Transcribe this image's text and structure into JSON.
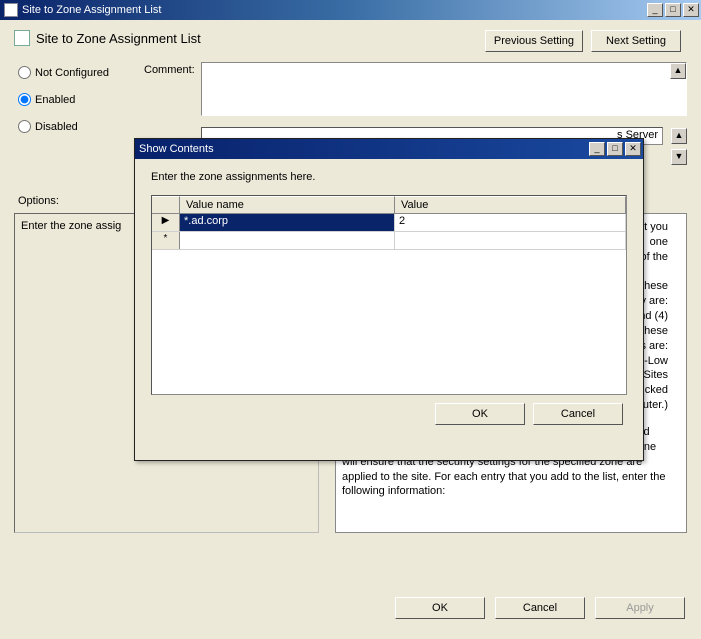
{
  "main_window": {
    "title": "Site to Zone Assignment List",
    "heading": "Site to Zone Assignment List",
    "nav": {
      "prev": "Previous Setting",
      "next": "Next Setting"
    },
    "radio": {
      "not_configured": "Not Configured",
      "enabled": "Enabled",
      "disabled": "Disabled",
      "selected": "enabled"
    },
    "comment_label": "Comment:",
    "comment_value": "",
    "supports_value": "s Server",
    "options_label": "Options:",
    "left_panel_text": "Enter the zone assig",
    "help_text_top": "t you\none\nll of the\n\n these\n They are:\n and (4)\n of these\ntings are:\nn-Low\nted Sites\ncked\nct your local computer.)",
    "help_text_bottom": "If you enable this policy setting, you can enter a list of sites and their related zone numbers. The association of a site with a zone will ensure that the security settings for the specified zone are applied to the site.  For each entry that you add to the list, enter the following information:",
    "buttons": {
      "ok": "OK",
      "cancel": "Cancel",
      "apply": "Apply"
    }
  },
  "dialog": {
    "title": "Show Contents",
    "instruction": "Enter the zone assignments here.",
    "columns": {
      "name": "Value name",
      "value": "Value"
    },
    "rows": [
      {
        "indicator": "▶",
        "name": "*.ad.corp",
        "value": "2",
        "selected": true
      },
      {
        "indicator": "*",
        "name": "",
        "value": "",
        "selected": false
      }
    ],
    "buttons": {
      "ok": "OK",
      "cancel": "Cancel"
    }
  },
  "window_controls": {
    "min": "_",
    "max": "□",
    "close": "✕"
  }
}
